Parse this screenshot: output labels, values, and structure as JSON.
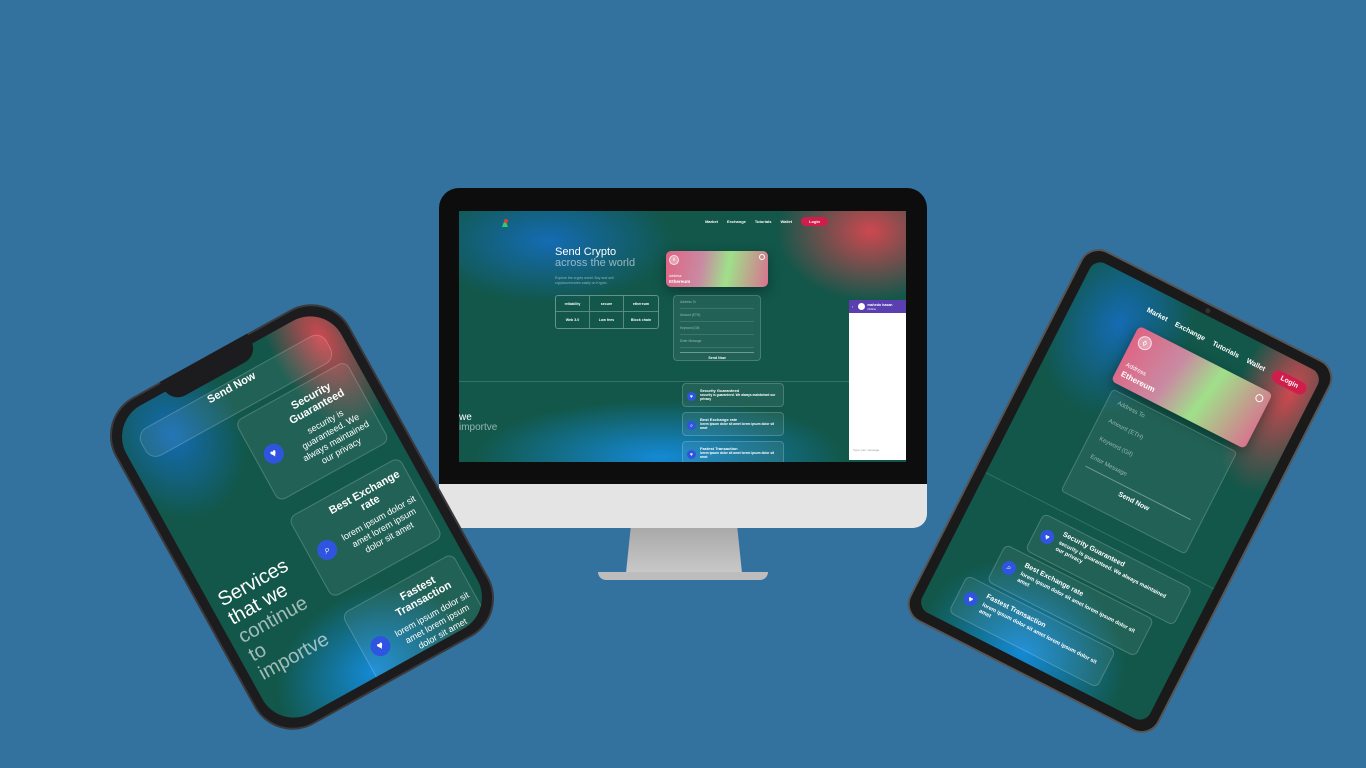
{
  "desktop": {
    "nav": {
      "links": [
        "Market",
        "Exchange",
        "Tutorials",
        "Wallet"
      ],
      "login": "Login"
    },
    "hero": {
      "title_line1": "Send Crypto",
      "title_line2": "across the world",
      "subtitle": "Explore the crypto world. Buy and sell cryptocurrencies easily on Krypto."
    },
    "features": [
      "reliability",
      "secure",
      "ethereum",
      "Web 3.0",
      "Low fees",
      "Block chain"
    ],
    "card": {
      "address_label": "Address",
      "network": "Ethereum"
    },
    "form": {
      "fields": [
        "Address To",
        "Amount (ETH)",
        "Keyword (Gif)",
        "Enter Message"
      ],
      "submit": "Send Now"
    },
    "services_heading": {
      "line1": "we",
      "line2": "importve"
    },
    "services": [
      {
        "title": "Security Guaranteed",
        "desc": "security is guaranteed. We always maintained our privacy"
      },
      {
        "title": "Best Exchange rate",
        "desc": "lorem ipsum dolor sit amet lorem ipsum dolor sit amet"
      },
      {
        "title": "Fastest Transaction",
        "desc": "lorem ipsum dolor sit amet lorem ipsum dolor sit amet"
      }
    ],
    "chat": {
      "name": "mahedo hasan",
      "status": "Online",
      "placeholder": "Type your message.."
    }
  },
  "phone": {
    "send_button": "Send Now",
    "heading_lines": [
      "Services",
      "that we",
      "continue",
      "to",
      "importve"
    ],
    "services": [
      {
        "title": "Security Guaranteed",
        "desc": "security is guaranteed. We always maintained our privacy"
      },
      {
        "title": "Best Exchange rate",
        "desc": "lorem ipsum dolor sit amet lorem ipsum dolor sit amet"
      },
      {
        "title": "Fastest Transaction",
        "desc": "lorem ipsum dolor sit amet lorem ipsum dolor sit amet"
      }
    ]
  },
  "tablet": {
    "nav": {
      "links": [
        "Market",
        "Exchange",
        "Tutorials",
        "Wallet"
      ],
      "login": "Login"
    },
    "card": {
      "address_label": "Address",
      "network": "Ethereum"
    },
    "form": {
      "fields": [
        "Address To",
        "Amount (ETH)",
        "Keyword (Gif)",
        "Enter Message"
      ],
      "submit": "Send Now"
    },
    "services": [
      {
        "title": "Security Guaranteed",
        "desc": "security is guaranteed. We always maintained our privacy"
      },
      {
        "title": "Best Exchange rate",
        "desc": "lorem ipsum dolor sit amet lorem ipsum dolor sit amet"
      },
      {
        "title": "Fastest Transaction",
        "desc": "lorem ipsum dolor sit amet lorem ipsum dolor sit amet"
      }
    ]
  },
  "colors": {
    "background": "#33719f",
    "app_green": "#12574a",
    "login_red": "#d11d4b",
    "icon_blue": "#2f55e0",
    "chat_purple": "#5b3fb0"
  },
  "icons": {
    "logo": "krypto-logo",
    "eth": "ethereum-icon",
    "security": "shield-heart-icon",
    "exchange": "search-icon",
    "fast": "heart-icon",
    "chat_avatar": "avatar-icon"
  }
}
